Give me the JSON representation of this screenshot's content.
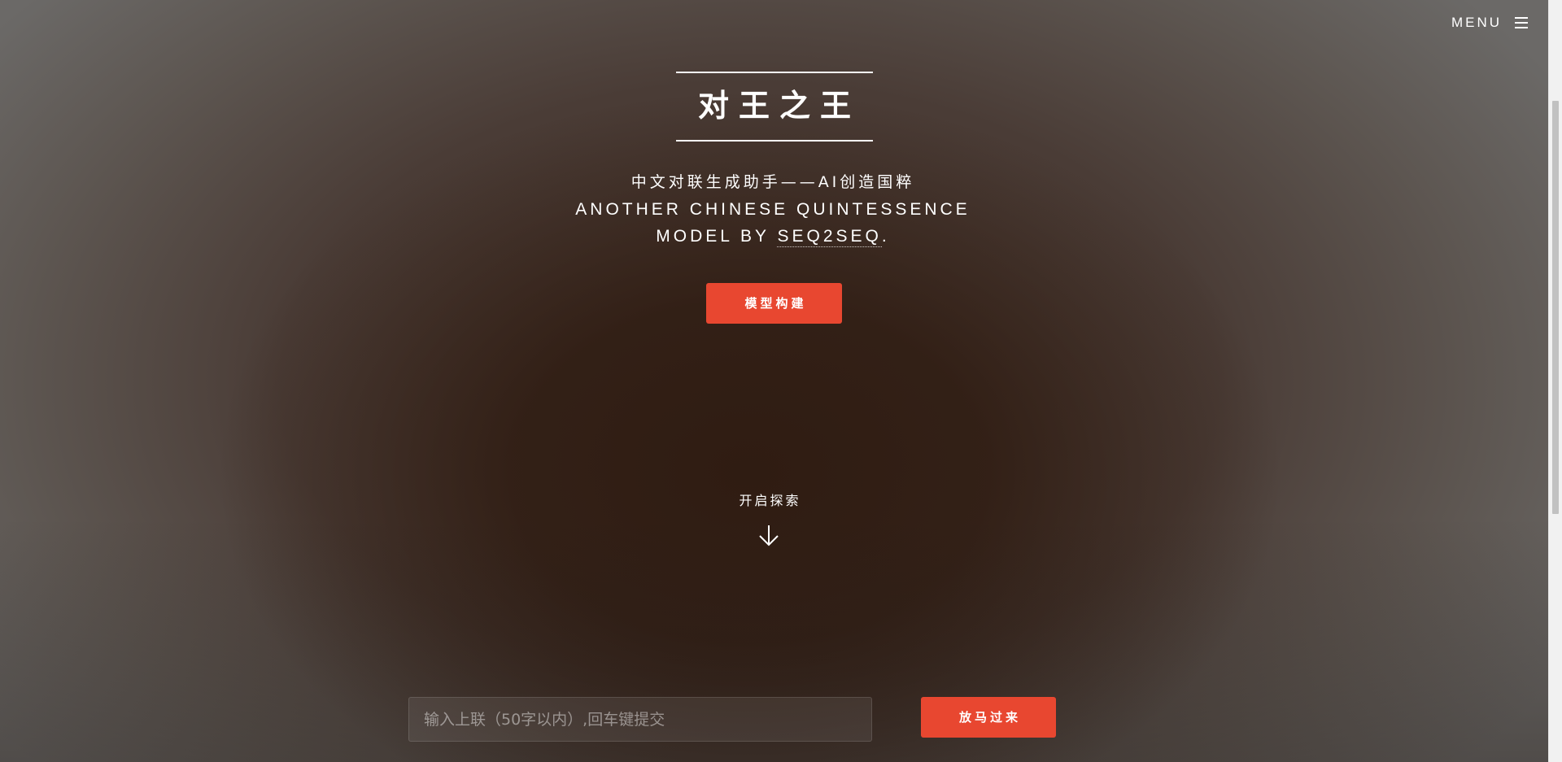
{
  "header": {
    "menu_label": "MENU",
    "menu_icon": "hamburger-icon"
  },
  "hero": {
    "title": "对王之王",
    "subtitle_cn": "中文对联生成助手——AI创造国粹",
    "subtitle_en_line1": "ANOTHER CHINESE QUINTESSENCE",
    "subtitle_en_line2_prefix": "MODEL BY ",
    "subtitle_en_link": "SEQ2SEQ",
    "subtitle_en_line2_suffix": ".",
    "model_button_label": "模型构建"
  },
  "explore": {
    "label": "开启探索",
    "icon": "arrow-down-icon"
  },
  "couplet_form": {
    "input_value": "",
    "input_placeholder": "输入上联（50字以内）,回车键提交",
    "submit_label": "放马过来"
  },
  "colors": {
    "accent": "#e84730",
    "text": "#ffffff"
  }
}
